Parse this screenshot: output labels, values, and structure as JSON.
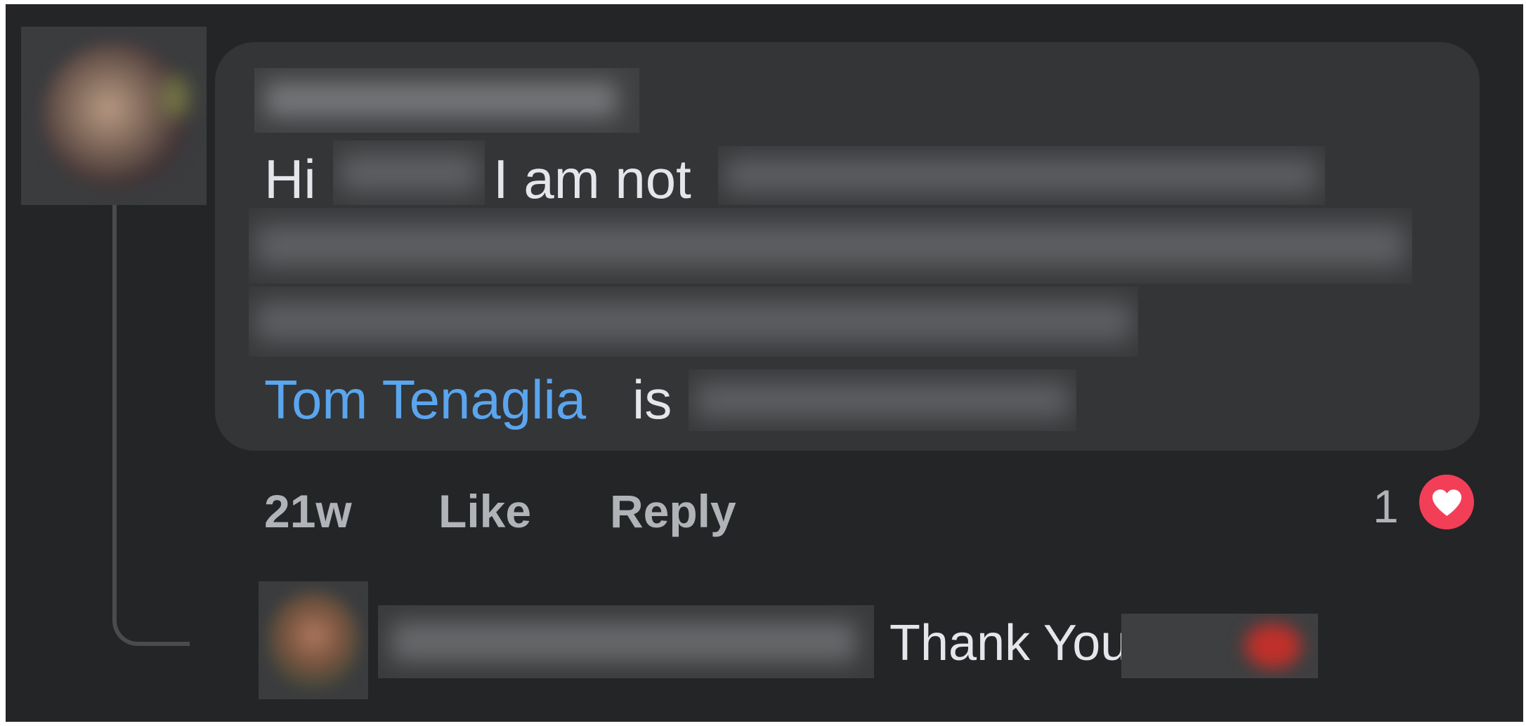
{
  "comment": {
    "greeting": "Hi",
    "text_part": "I am not",
    "mention": "Tom Tenaglia",
    "after_mention": "is",
    "timestamp": "21w",
    "like_label": "Like",
    "reply_label": "Reply",
    "reaction_count": "1",
    "reaction_icon": "heart-icon"
  },
  "reply": {
    "text": "Thank You"
  },
  "colors": {
    "background": "#242527",
    "bubble": "#343537",
    "text": "#e4e6eb",
    "mention": "#5aa5ee",
    "action_text": "#b0b3b8",
    "reaction": "#f33e58"
  }
}
